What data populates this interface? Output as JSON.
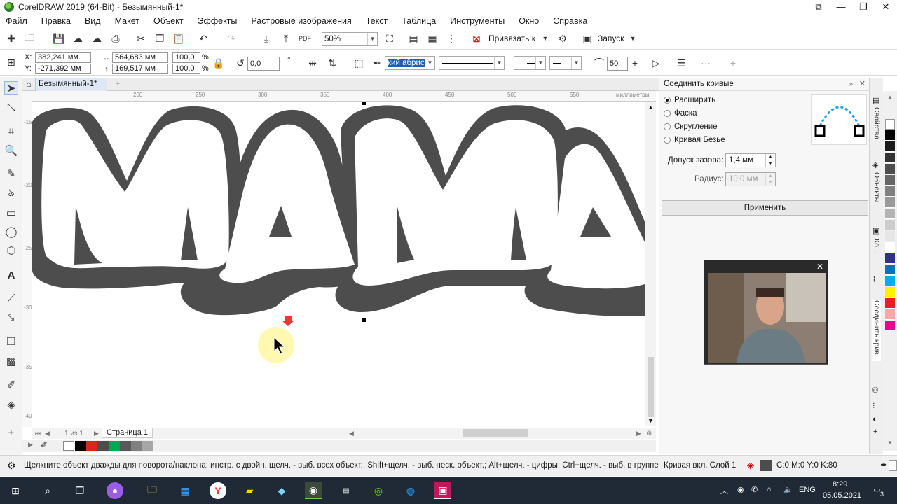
{
  "window": {
    "title": "CorelDRAW 2019 (64-Bit) - Безымянный-1*"
  },
  "menu": [
    "Файл",
    "Правка",
    "Вид",
    "Макет",
    "Объект",
    "Эффекты",
    "Растровые изображения",
    "Текст",
    "Таблица",
    "Инструменты",
    "Окно",
    "Справка"
  ],
  "toolbar": {
    "zoom": "50%",
    "snap_label": "Привязать к",
    "launch_label": "Запуск"
  },
  "propbar": {
    "x_label": "X:",
    "x": "382,241 мм",
    "y_label": "Y:",
    "y": "-271,392 мм",
    "w": "564,683 мм",
    "h": "169,517 мм",
    "scale_x": "100,0",
    "scale_y": "100,0",
    "pct": "%",
    "rotation": "0,0",
    "deg": "°",
    "outline_width": "кий абрис",
    "curve_smooth": "50"
  },
  "document": {
    "tab": "Безымянный-1*",
    "page_tab": "Страница 1",
    "page_nav": "1 из 1",
    "units": "миллиметры",
    "ruler_h": [
      "200",
      "250",
      "300",
      "350",
      "400",
      "450",
      "500",
      "550"
    ],
    "ruler_v": [
      "-150",
      "-200",
      "-250",
      "-300",
      "-350",
      "-400"
    ]
  },
  "docker": {
    "title": "Соединить кривые",
    "options": [
      {
        "label": "Расширить",
        "selected": true
      },
      {
        "label": "Фаска",
        "selected": false
      },
      {
        "label": "Скругление",
        "selected": false
      },
      {
        "label": "Кривая Безье",
        "selected": false
      }
    ],
    "gap_label": "Допуск зазора:",
    "gap_value": "1,4 мм",
    "radius_label": "Радиус:",
    "radius_value": "10,0 мм",
    "apply_label": "Применить",
    "side_tabs": [
      "Свойства",
      "Объекты",
      "Ко...",
      "Соединить крив..."
    ]
  },
  "status": {
    "message": "Щелкните объект дважды для поворота/наклона; инстр. с двойн. щелч. - выб. всех объект.; Shift+щелч. - выб. неск. объект.; Alt+щелч. - цифры; Ctrl+щелч. - выб. в группе",
    "layer": "Кривая вкл. Слой 1",
    "cmyk": "C:0 M:0 Y:0 K:80"
  },
  "taskbar": {
    "lang": "ENG",
    "time": "8:29",
    "date": "05.05.2021",
    "notif_count": "3"
  },
  "colors": {
    "shape_fill": "#4d4d4d",
    "accent": "#1e5fb3",
    "taskbar": "#1f2a36"
  }
}
